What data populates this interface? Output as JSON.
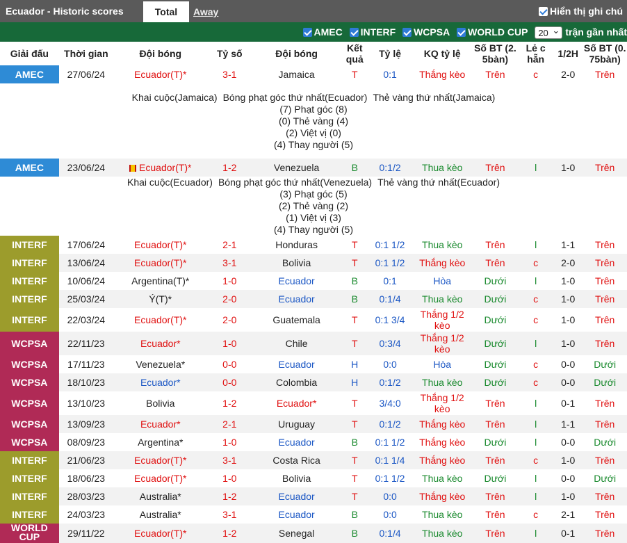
{
  "header": {
    "title": "Ecuador - Historic scores",
    "tab_total": "Total",
    "tab_away": "Away",
    "show_label": "Hiển thị ghi chú"
  },
  "filters": {
    "items": [
      "AMEC",
      "INTERF",
      "WCPSA",
      "WORLD CUP"
    ],
    "count_value": "20",
    "count_suffix": "trận gần nhất"
  },
  "columns": [
    "Giải đấu",
    "Thời gian",
    "Đội bóng",
    "Tỷ số",
    "Đội bóng",
    "Kết quả",
    "Tỷ lệ",
    "KQ tỷ lệ",
    "Số BT (2. 5bàn)",
    "Lẻ c hẵn",
    "1/2H",
    "Số BT (0. 75bàn)"
  ],
  "colors": {
    "AMEC": "#2e8bd6",
    "INTERF": "#9c9c2c",
    "WCPSA": "#b02a56",
    "WORLD CUP": "#b02a56",
    "home_team": "#e01010",
    "away_team": "#1a56c4",
    "win": "#e01010",
    "draw": "#1a56c4",
    "loss": "#1a8a2e"
  },
  "matches": [
    {
      "comp": "AMEC",
      "date": "27/06/24",
      "home": "Ecuador(T)*",
      "score": "3-1",
      "away": "Jamaica",
      "result": "T",
      "odds": "0:1",
      "odds_result": "Thắng kèo",
      "ou": "Trên",
      "oe": "c",
      "half": "2-0",
      "ou2": "Trên",
      "detail": {
        "line1": [
          "Khai cuộc(Jamaica)",
          "Bóng phạt góc thứ nhất(Ecuador)",
          "Thẻ vàng thứ nhất(Jamaica)"
        ],
        "lines": [
          "(7) Phạt góc (8)",
          "(0) Thẻ vàng (4)",
          "(2) Việt vị (0)",
          "(4) Thay người (5)"
        ]
      }
    },
    {
      "comp": "AMEC",
      "date": "23/06/24",
      "home": "Ecuador(T)*",
      "score": "1-2",
      "away": "Venezuela",
      "result": "B",
      "odds": "0:1/2",
      "odds_result": "Thua kèo",
      "ou": "Trên",
      "oe": "l",
      "half": "1-0",
      "ou2": "Trên",
      "detail": {
        "line1": [
          "Khai cuộc(Ecuador)",
          "Bóng phạt góc thứ nhất(Venezuela)",
          "Thẻ vàng thứ nhất(Ecuador)"
        ],
        "lines": [
          "(3) Phạt góc (5)",
          "(2) Thẻ vàng (2)",
          "(1) Việt vị (3)",
          "(4) Thay người (5)"
        ]
      }
    },
    {
      "comp": "INTERF",
      "date": "17/06/24",
      "home": "Ecuador(T)*",
      "score": "2-1",
      "away": "Honduras",
      "result": "T",
      "odds": "0:1 1/2",
      "odds_result": "Thua kèo",
      "ou": "Trên",
      "oe": "l",
      "half": "1-1",
      "ou2": "Trên"
    },
    {
      "comp": "INTERF",
      "date": "13/06/24",
      "home": "Ecuador(T)*",
      "score": "3-1",
      "away": "Bolivia",
      "result": "T",
      "odds": "0:1 1/2",
      "odds_result": "Thắng kèo",
      "ou": "Trên",
      "oe": "c",
      "half": "2-0",
      "ou2": "Trên"
    },
    {
      "comp": "INTERF",
      "date": "10/06/24",
      "home": "Argentina(T)*",
      "score": "1-0",
      "away": "Ecuador",
      "result": "B",
      "odds": "0:1",
      "odds_result": "Hòa",
      "ou": "Dưới",
      "oe": "l",
      "half": "1-0",
      "ou2": "Trên"
    },
    {
      "comp": "INTERF",
      "date": "25/03/24",
      "home": "Ý(T)*",
      "score": "2-0",
      "away": "Ecuador",
      "result": "B",
      "odds": "0:1/4",
      "odds_result": "Thua kèo",
      "ou": "Dưới",
      "oe": "c",
      "half": "1-0",
      "ou2": "Trên"
    },
    {
      "comp": "INTERF",
      "date": "22/03/24",
      "home": "Ecuador(T)*",
      "score": "2-0",
      "away": "Guatemala",
      "result": "T",
      "odds": "0:1 3/4",
      "odds_result": "Thắng 1/2 kèo",
      "ou": "Dưới",
      "oe": "c",
      "half": "1-0",
      "ou2": "Trên"
    },
    {
      "comp": "WCPSA",
      "date": "22/11/23",
      "home": "Ecuador*",
      "score": "1-0",
      "away": "Chile",
      "result": "T",
      "odds": "0:3/4",
      "odds_result": "Thắng 1/2 kèo",
      "ou": "Dưới",
      "oe": "l",
      "half": "1-0",
      "ou2": "Trên"
    },
    {
      "comp": "WCPSA",
      "date": "17/11/23",
      "home": "Venezuela*",
      "score": "0-0",
      "away": "Ecuador",
      "result": "H",
      "odds": "0:0",
      "odds_result": "Hòa",
      "ou": "Dưới",
      "oe": "c",
      "half": "0-0",
      "ou2": "Dưới"
    },
    {
      "comp": "WCPSA",
      "date": "18/10/23",
      "home": "Ecuador*",
      "score": "0-0",
      "away": "Colombia",
      "result": "H",
      "odds": "0:1/2",
      "odds_result": "Thua kèo",
      "ou": "Dưới",
      "oe": "c",
      "half": "0-0",
      "ou2": "Dưới"
    },
    {
      "comp": "WCPSA",
      "date": "13/10/23",
      "home": "Bolivia",
      "score": "1-2",
      "away": "Ecuador*",
      "result": "T",
      "odds": "3/4:0",
      "odds_result": "Thắng 1/2 kèo",
      "ou": "Trên",
      "oe": "l",
      "half": "0-1",
      "ou2": "Trên"
    },
    {
      "comp": "WCPSA",
      "date": "13/09/23",
      "home": "Ecuador*",
      "score": "2-1",
      "away": "Uruguay",
      "result": "T",
      "odds": "0:1/2",
      "odds_result": "Thắng kèo",
      "ou": "Trên",
      "oe": "l",
      "half": "1-1",
      "ou2": "Trên"
    },
    {
      "comp": "WCPSA",
      "date": "08/09/23",
      "home": "Argentina*",
      "score": "1-0",
      "away": "Ecuador",
      "result": "B",
      "odds": "0:1 1/2",
      "odds_result": "Thắng kèo",
      "ou": "Dưới",
      "oe": "l",
      "half": "0-0",
      "ou2": "Dưới"
    },
    {
      "comp": "INTERF",
      "date": "21/06/23",
      "home": "Ecuador(T)*",
      "score": "3-1",
      "away": "Costa Rica",
      "result": "T",
      "odds": "0:1 1/4",
      "odds_result": "Thắng kèo",
      "ou": "Trên",
      "oe": "c",
      "half": "1-0",
      "ou2": "Trên"
    },
    {
      "comp": "INTERF",
      "date": "18/06/23",
      "home": "Ecuador(T)*",
      "score": "1-0",
      "away": "Bolivia",
      "result": "T",
      "odds": "0:1 1/2",
      "odds_result": "Thua kèo",
      "ou": "Dưới",
      "oe": "l",
      "half": "0-0",
      "ou2": "Dưới"
    },
    {
      "comp": "INTERF",
      "date": "28/03/23",
      "home": "Australia*",
      "score": "1-2",
      "away": "Ecuador",
      "result": "T",
      "odds": "0:0",
      "odds_result": "Thắng kèo",
      "ou": "Trên",
      "oe": "l",
      "half": "1-0",
      "ou2": "Trên"
    },
    {
      "comp": "INTERF",
      "date": "24/03/23",
      "home": "Australia*",
      "score": "3-1",
      "away": "Ecuador",
      "result": "B",
      "odds": "0:0",
      "odds_result": "Thua kèo",
      "ou": "Trên",
      "oe": "c",
      "half": "2-1",
      "ou2": "Trên"
    },
    {
      "comp": "WORLD CUP",
      "date": "29/11/22",
      "home": "Ecuador(T)*",
      "score": "1-2",
      "away": "Senegal",
      "result": "B",
      "odds": "0:1/4",
      "odds_result": "Thua kèo",
      "ou": "Trên",
      "oe": "l",
      "half": "0-1",
      "ou2": "Trên"
    }
  ]
}
